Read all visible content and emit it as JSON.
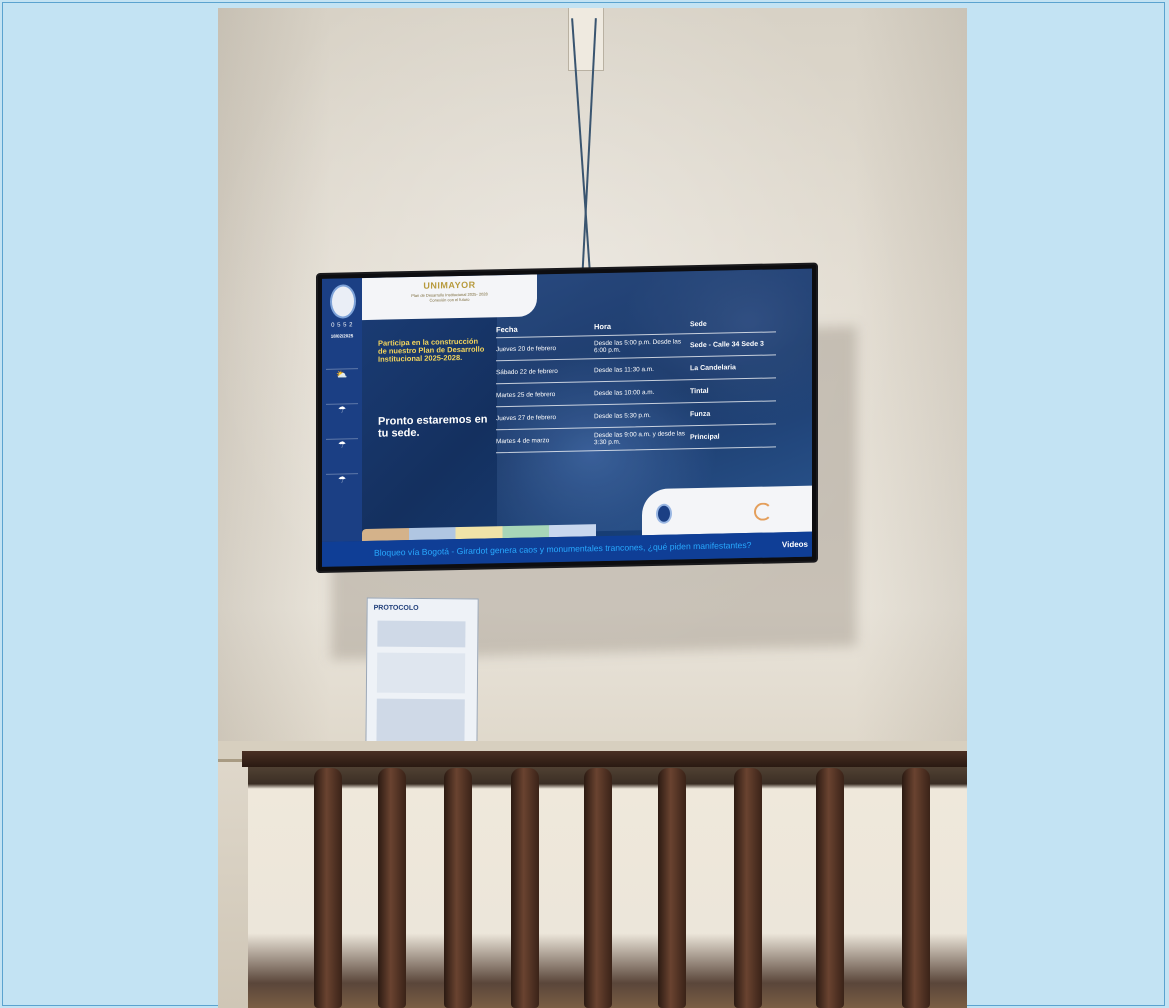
{
  "screen": {
    "brand": "UNIMAYOR",
    "brand_sub_1": "Plan de Desarrollo Institucional 2025- 2028",
    "brand_sub_2": "Conexión con el futuro",
    "clock": "0 5 5 2",
    "date": "18/02/2025",
    "headline_yellow": "Participa en la construcción de nuestro Plan de Desarrollo Institucional 2025-2028.",
    "headline_white": "Pronto estaremos en tu sede.",
    "table": {
      "headers": [
        "Fecha",
        "Hora",
        "Sede"
      ],
      "rows": [
        {
          "fecha": "Jueves 20 de febrero",
          "hora": "Desde las 5:00 p.m. Desde las 6:00 p.m.",
          "sede": "Sede - Calle 34 Sede 3"
        },
        {
          "fecha": "Sábado 22 de febrero",
          "hora": "Desde las 11:30 a.m.",
          "sede": "La Candelaria"
        },
        {
          "fecha": "Martes 25 de febrero",
          "hora": "Desde las 10:00 a.m.",
          "sede": "Tintal"
        },
        {
          "fecha": "Jueves 27 de febrero",
          "hora": "Desde las 5:30 p.m.",
          "sede": "Funza"
        },
        {
          "fecha": "Martes 4 de marzo",
          "hora": "Desde las 9:00 a.m. y desde las 3:30 p.m.",
          "sede": "Principal"
        }
      ]
    },
    "ticker": "Bloqueo vía Bogotá - Girardot genera caos y monumentales trancones, ¿qué piden manifestantes?",
    "ticker_tag": "Videos"
  },
  "poster": {
    "title": "PROTOCOLO"
  }
}
